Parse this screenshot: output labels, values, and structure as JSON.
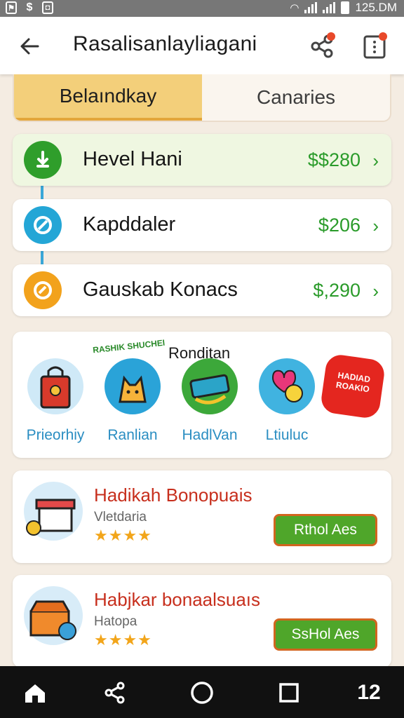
{
  "status_bar": {
    "time": "125.DM",
    "left_icons": [
      "notification-icon",
      "dollar-icon",
      "app-icon"
    ],
    "right_icons": [
      "wifi-icon",
      "signal-icon",
      "signal-icon",
      "battery-icon"
    ]
  },
  "app_bar": {
    "title": "Rasalisanlayliagani",
    "actions": [
      "share-icon",
      "more-icon"
    ]
  },
  "tabs": [
    {
      "label": "Belaındkay",
      "active": true
    },
    {
      "label": "Canaries",
      "active": false
    }
  ],
  "timeline": [
    {
      "name": "Hevel Hani",
      "amount": "$$280",
      "icon": "download-icon",
      "color": "#2f9e2b"
    },
    {
      "name": "Kapddaler",
      "amount": "$206",
      "icon": "b-logo-icon",
      "color": "#24a6d6"
    },
    {
      "name": "Gauskab Konacs",
      "amount": "$,290",
      "icon": "c-logo-icon",
      "color": "#f2a21c"
    }
  ],
  "categories": {
    "title": "Ronditan",
    "sticker": "RASHIK SHUCHEI",
    "items": [
      {
        "label": "Prieorhiy",
        "icon": "shopping-bag-icon"
      },
      {
        "label": "Ranlian",
        "icon": "cat-icon"
      },
      {
        "label": "HadlVan",
        "icon": "ticket-icon"
      },
      {
        "label": "Ltiuluc",
        "icon": "heart-icon"
      },
      {
        "label": "",
        "icon": "badge-icon"
      }
    ],
    "badge_text": "HADIAD ROAKIO"
  },
  "offers": [
    {
      "title": "Hadikah Bonopuais",
      "subtitle": "Vletdaria",
      "stars": "★★★★",
      "button": "Rthol Aes",
      "icon": "gift-box-icon"
    },
    {
      "title": "Habjkar bonaalsuaıs",
      "subtitle": "Hatopa",
      "stars": "★★★★",
      "button": "SsHol Aes",
      "icon": "treasure-chest-icon"
    }
  ],
  "nav_bar": {
    "items": [
      "home-icon",
      "share-icon",
      "circle-home-icon",
      "square-recents-icon",
      "profile-icon"
    ],
    "profile_text": "12"
  }
}
